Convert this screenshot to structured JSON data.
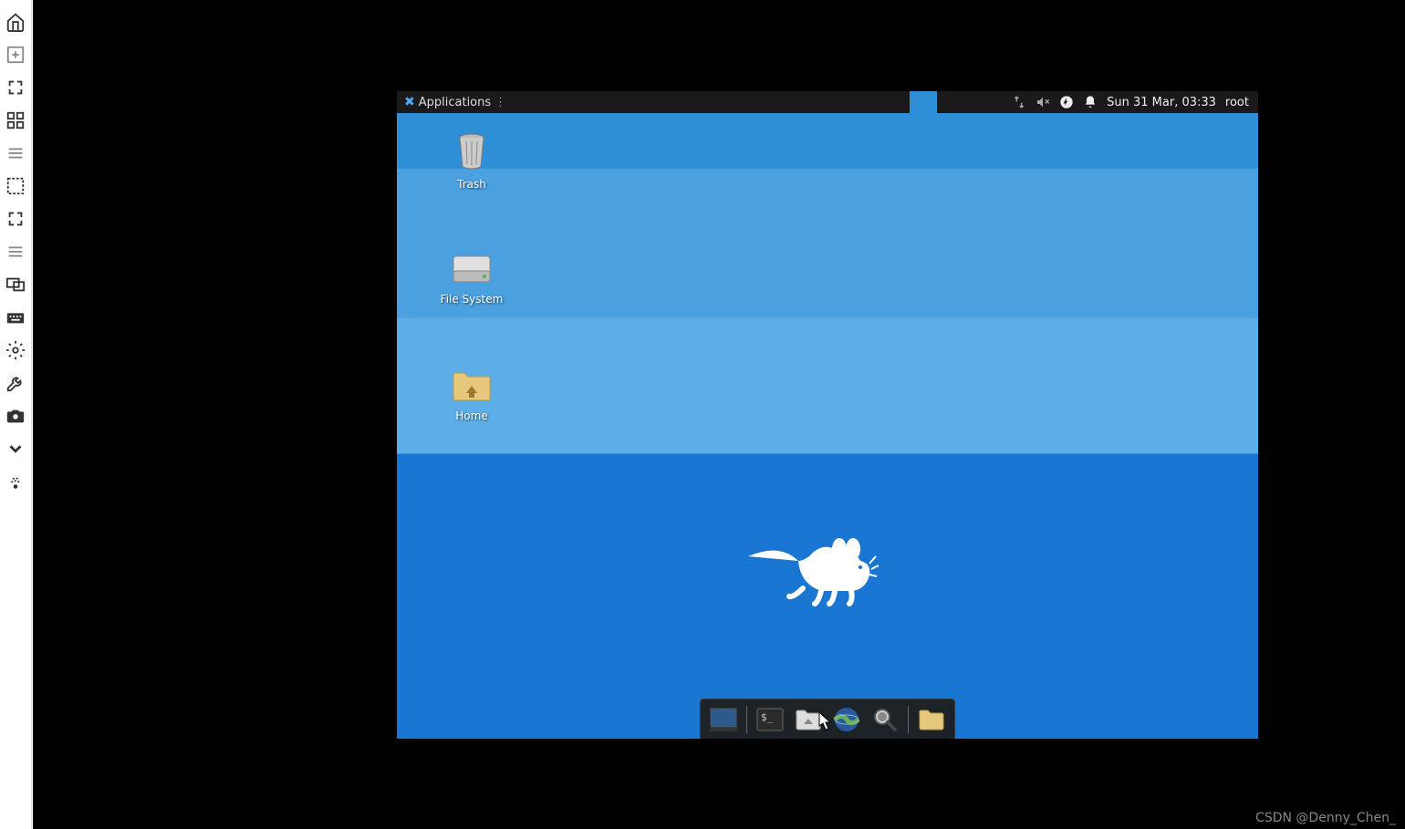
{
  "toolbar": {
    "items": [
      "home",
      "new-connection",
      "fullscreen-toggle",
      "fullscreen",
      "menu",
      "scale-fullscreen",
      "scale",
      "menu2",
      "multi-monitor",
      "keyboard",
      "preferences",
      "tools",
      "screenshot",
      "expand",
      "disconnect"
    ]
  },
  "top_panel": {
    "menu_label": "Applications",
    "datetime": "Sun 31 Mar, 03:33",
    "user": "root"
  },
  "desktop_icons": [
    {
      "id": "trash",
      "label": "Trash"
    },
    {
      "id": "filesystem",
      "label": "File System"
    },
    {
      "id": "home",
      "label": "Home"
    }
  ],
  "dock": [
    "show-desktop",
    "terminal",
    "file-manager",
    "web-browser",
    "app-finder",
    "home-folder"
  ],
  "watermark": "CSDN @Denny_Chen_"
}
